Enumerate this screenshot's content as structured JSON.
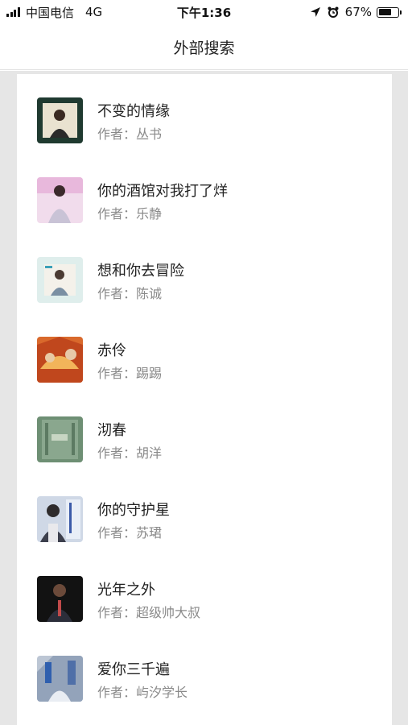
{
  "status_bar": {
    "carrier": "中国电信",
    "network": "4G",
    "time": "下午1:36",
    "battery": "67%",
    "battery_level": 0.67
  },
  "nav": {
    "title": "外部搜索"
  },
  "author_prefix": "作者：",
  "songs": [
    {
      "title": "不变的情缘",
      "author": "丛书"
    },
    {
      "title": "你的酒馆对我打了烊",
      "author": "乐静"
    },
    {
      "title": "想和你去冒险",
      "author": "陈诚"
    },
    {
      "title": "赤伶",
      "author": "踢踢"
    },
    {
      "title": "沏春",
      "author": "胡洋"
    },
    {
      "title": "你的守护星",
      "author": "苏珺"
    },
    {
      "title": "光年之外",
      "author": "超级帅大叔"
    },
    {
      "title": "爱你三千遍",
      "author": "屿汐学长"
    }
  ]
}
